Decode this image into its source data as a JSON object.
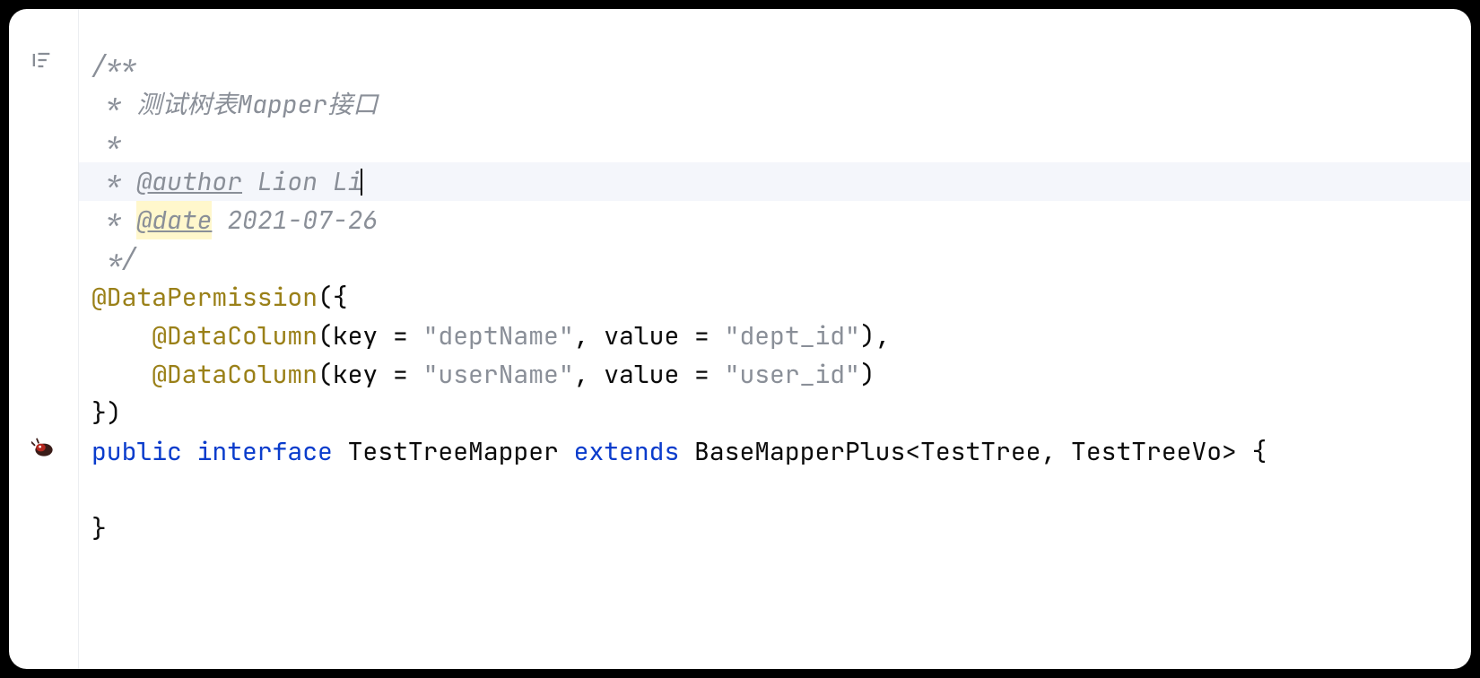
{
  "code": {
    "lines": [
      {
        "kind": "comment_open",
        "text": "/**"
      },
      {
        "kind": "comment_body",
        "prefix": " * ",
        "text": "测试树表Mapper接口"
      },
      {
        "kind": "comment_body",
        "prefix": " *",
        "text": ""
      },
      {
        "kind": "comment_tag",
        "prefix": " * ",
        "tag": "@author",
        "value": " Lion Li",
        "active": true
      },
      {
        "kind": "comment_tag",
        "prefix": " * ",
        "tag": "@date",
        "value": " 2021-07-26",
        "tag_highlight": true
      },
      {
        "kind": "comment_close",
        "text": " */"
      },
      {
        "kind": "annotation_open",
        "name": "@DataPermission",
        "suffix": "({"
      },
      {
        "kind": "annotation_item",
        "indent": "    ",
        "name": "@DataColumn",
        "open": "(key = ",
        "arg1": "\"deptName\"",
        "mid": ", value = ",
        "arg2": "\"dept_id\"",
        "close": "),"
      },
      {
        "kind": "annotation_item",
        "indent": "    ",
        "name": "@DataColumn",
        "open": "(key = ",
        "arg1": "\"userName\"",
        "mid": ", value = ",
        "arg2": "\"user_id\"",
        "close": ")"
      },
      {
        "kind": "annotation_close",
        "text": "})"
      },
      {
        "kind": "declaration",
        "tokens": [
          {
            "t": "public ",
            "cls": "c-keyword"
          },
          {
            "t": "interface ",
            "cls": "c-keyword"
          },
          {
            "t": "TestTreeMapper ",
            "cls": "c-plain"
          },
          {
            "t": "extends ",
            "cls": "c-keyword"
          },
          {
            "t": "BaseMapperPlus<TestTree, TestTreeVo> {",
            "cls": "c-plain"
          }
        ],
        "gutter_icon": "bean"
      },
      {
        "kind": "blank",
        "text": ""
      },
      {
        "kind": "plain",
        "text": "}"
      }
    ]
  },
  "gutter": {
    "first_icon_title": "structure-filter"
  }
}
